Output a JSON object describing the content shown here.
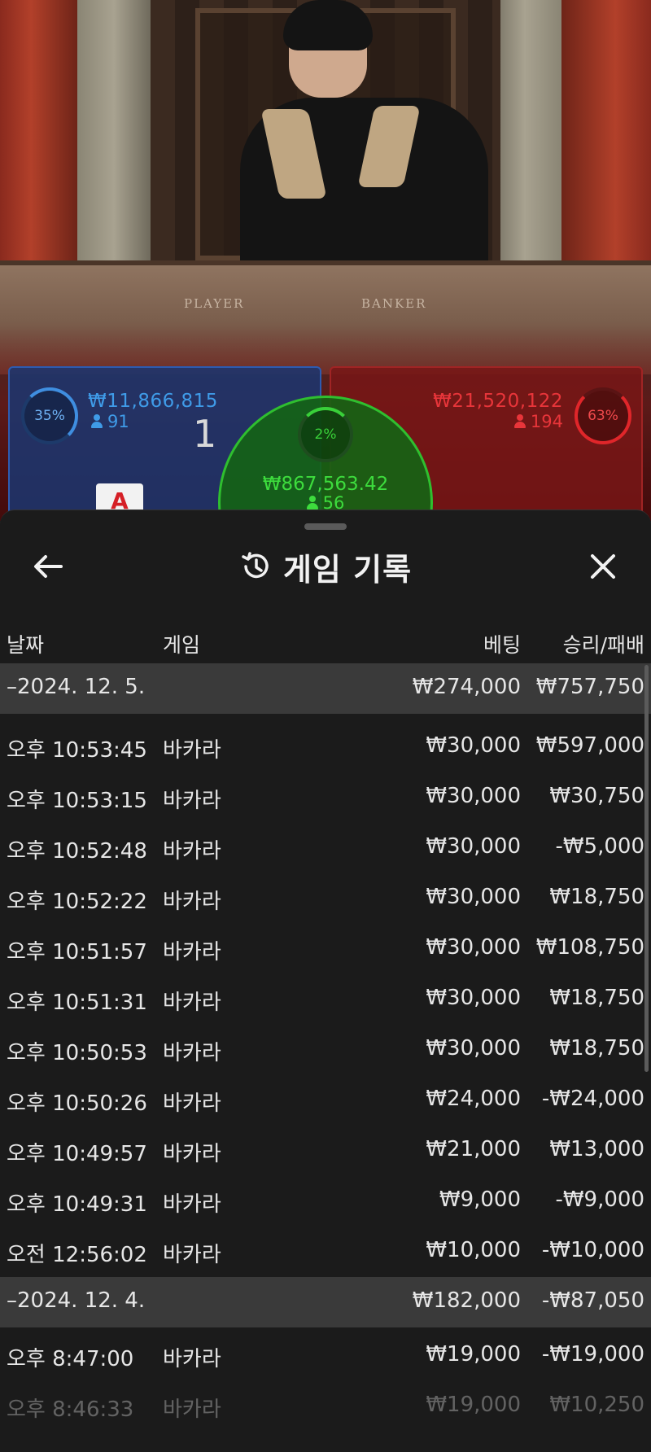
{
  "video": {
    "table_labels": [
      "PLAYER",
      "BANKER"
    ]
  },
  "betting": {
    "player": {
      "percent": "35%",
      "amount": "₩11,866,815",
      "count": "91",
      "score": "1",
      "card": "A"
    },
    "banker": {
      "percent": "63%",
      "amount": "₩21,520,122",
      "count": "194"
    },
    "tie": {
      "percent": "2%",
      "amount": "₩867,563.42",
      "count": "56"
    },
    "colors": {
      "player": "#3f9be8",
      "banker": "#e8353a",
      "tie": "#3ddc3d"
    }
  },
  "sheet": {
    "title": "게임 기록",
    "icons": {
      "back": "arrow-left-icon",
      "history": "history-icon",
      "close": "close-icon"
    },
    "columns": {
      "date": "날짜",
      "game": "게임",
      "bet": "베팅",
      "result": "승리/패배"
    },
    "groups": [
      {
        "date": "–2024. 12. 5.",
        "bet_total": "₩274,000",
        "result_total": "₩757,750",
        "rows": [
          {
            "time": "오후 10:53:45",
            "game": "바카라",
            "bet": "₩30,000",
            "result": "₩597,000"
          },
          {
            "time": "오후 10:53:15",
            "game": "바카라",
            "bet": "₩30,000",
            "result": "₩30,750"
          },
          {
            "time": "오후 10:52:48",
            "game": "바카라",
            "bet": "₩30,000",
            "result": "-₩5,000"
          },
          {
            "time": "오후 10:52:22",
            "game": "바카라",
            "bet": "₩30,000",
            "result": "₩18,750"
          },
          {
            "time": "오후 10:51:57",
            "game": "바카라",
            "bet": "₩30,000",
            "result": "₩108,750"
          },
          {
            "time": "오후 10:51:31",
            "game": "바카라",
            "bet": "₩30,000",
            "result": "₩18,750"
          },
          {
            "time": "오후 10:50:53",
            "game": "바카라",
            "bet": "₩30,000",
            "result": "₩18,750"
          },
          {
            "time": "오후 10:50:26",
            "game": "바카라",
            "bet": "₩24,000",
            "result": "-₩24,000"
          },
          {
            "time": "오후 10:49:57",
            "game": "바카라",
            "bet": "₩21,000",
            "result": "₩13,000"
          },
          {
            "time": "오후 10:49:31",
            "game": "바카라",
            "bet": "₩9,000",
            "result": "-₩9,000"
          },
          {
            "time": "오전 12:56:02",
            "game": "바카라",
            "bet": "₩10,000",
            "result": "-₩10,000"
          }
        ]
      },
      {
        "date": "–2024. 12. 4.",
        "bet_total": "₩182,000",
        "result_total": "-₩87,050",
        "rows": [
          {
            "time": "오후 8:47:00",
            "game": "바카라",
            "bet": "₩19,000",
            "result": "-₩19,000"
          },
          {
            "time": "오후 8:46:33",
            "game": "바카라",
            "bet": "₩19,000",
            "result": "₩10,250"
          }
        ]
      }
    ]
  }
}
